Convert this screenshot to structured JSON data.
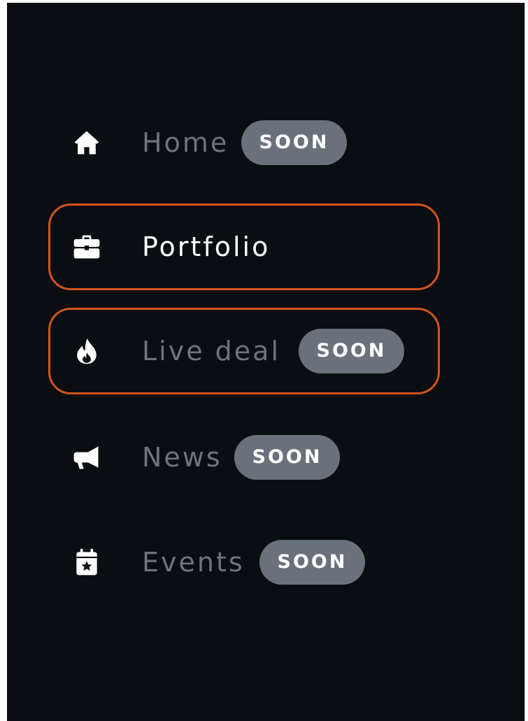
{
  "nav": {
    "items": [
      {
        "label": "Home",
        "icon": "home-icon",
        "badge": "SOON",
        "active": false,
        "highlighted": false
      },
      {
        "label": "Portfolio",
        "icon": "briefcase-icon",
        "badge": "",
        "active": true,
        "highlighted": true
      },
      {
        "label": "Live deal",
        "icon": "fire-icon",
        "badge": "SOON",
        "active": false,
        "highlighted": true
      },
      {
        "label": "News",
        "icon": "megaphone-icon",
        "badge": "SOON",
        "active": false,
        "highlighted": false
      },
      {
        "label": "Events",
        "icon": "calendar-star-icon",
        "badge": "SOON",
        "active": false,
        "highlighted": false
      }
    ]
  },
  "colors": {
    "background": "#0a0d12",
    "highlight_border": "#d2551f",
    "badge_background": "#6a717b",
    "inactive_text": "#6f737a",
    "active_text": "#ffffff"
  }
}
